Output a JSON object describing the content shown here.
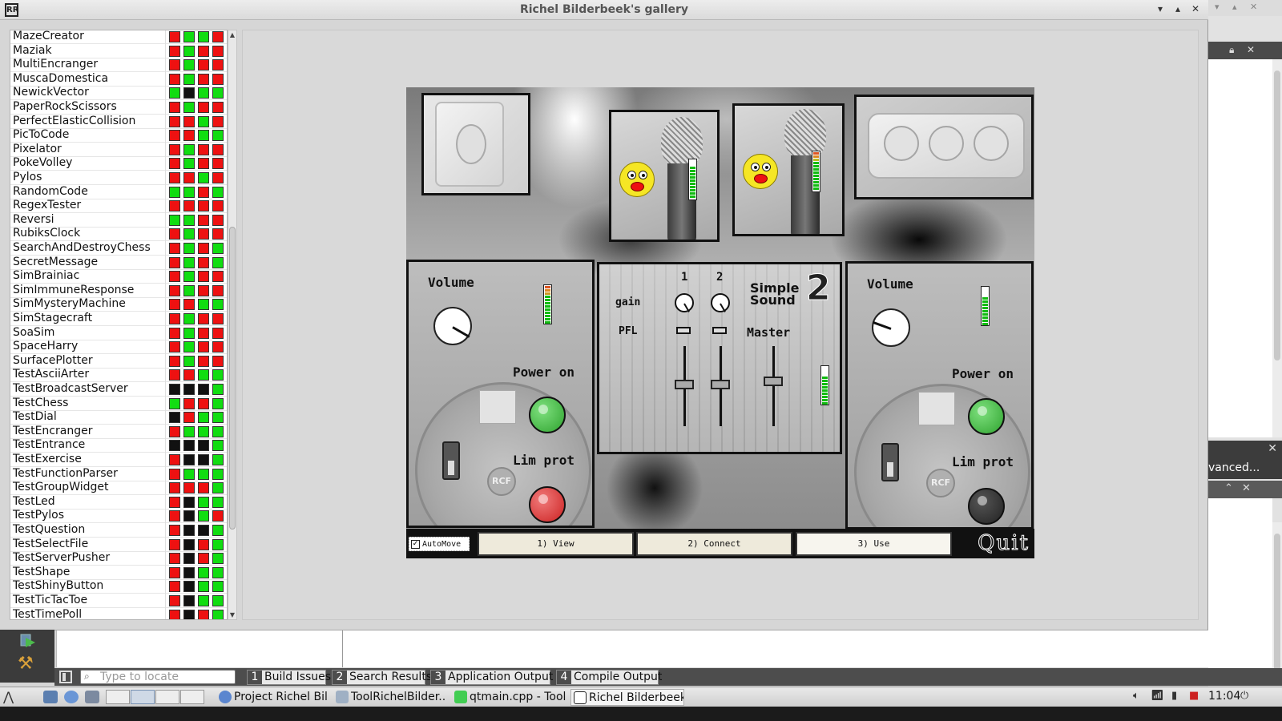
{
  "window": {
    "title": "Richel Bilderbeek's gallery",
    "logo": "RR",
    "controls": [
      "▾",
      "▴",
      "✕"
    ]
  },
  "tools": [
    {
      "name": "MazeCreator",
      "status": [
        "red",
        "green",
        "green",
        "red"
      ]
    },
    {
      "name": "Maziak",
      "status": [
        "red",
        "green",
        "red",
        "red"
      ]
    },
    {
      "name": "MultiEncranger",
      "status": [
        "red",
        "green",
        "red",
        "red"
      ]
    },
    {
      "name": "MuscaDomestica",
      "status": [
        "red",
        "green",
        "red",
        "red"
      ]
    },
    {
      "name": "NewickVector",
      "status": [
        "green",
        "black",
        "green",
        "green"
      ]
    },
    {
      "name": "PaperRockScissors",
      "status": [
        "red",
        "green",
        "red",
        "red"
      ]
    },
    {
      "name": "PerfectElasticCollision",
      "status": [
        "red",
        "red",
        "green",
        "red"
      ]
    },
    {
      "name": "PicToCode",
      "status": [
        "red",
        "red",
        "green",
        "green"
      ]
    },
    {
      "name": "Pixelator",
      "status": [
        "red",
        "green",
        "red",
        "red"
      ]
    },
    {
      "name": "PokeVolley",
      "status": [
        "red",
        "green",
        "red",
        "red"
      ]
    },
    {
      "name": "Pylos",
      "status": [
        "red",
        "red",
        "green",
        "red"
      ]
    },
    {
      "name": "RandomCode",
      "status": [
        "green",
        "green",
        "red",
        "green"
      ]
    },
    {
      "name": "RegexTester",
      "status": [
        "red",
        "red",
        "red",
        "red"
      ]
    },
    {
      "name": "Reversi",
      "status": [
        "green",
        "green",
        "red",
        "red"
      ]
    },
    {
      "name": "RubiksClock",
      "status": [
        "red",
        "green",
        "red",
        "red"
      ]
    },
    {
      "name": "SearchAndDestroyChess",
      "status": [
        "red",
        "green",
        "red",
        "green"
      ]
    },
    {
      "name": "SecretMessage",
      "status": [
        "red",
        "green",
        "red",
        "green"
      ]
    },
    {
      "name": "SimBrainiac",
      "status": [
        "red",
        "green",
        "red",
        "red"
      ]
    },
    {
      "name": "SimImmuneResponse",
      "status": [
        "red",
        "green",
        "red",
        "red"
      ]
    },
    {
      "name": "SimMysteryMachine",
      "status": [
        "red",
        "red",
        "green",
        "green"
      ]
    },
    {
      "name": "SimStagecraft",
      "status": [
        "red",
        "green",
        "red",
        "red"
      ]
    },
    {
      "name": "SoaSim",
      "status": [
        "red",
        "green",
        "red",
        "red"
      ]
    },
    {
      "name": "SpaceHarry",
      "status": [
        "red",
        "green",
        "red",
        "red"
      ]
    },
    {
      "name": "SurfacePlotter",
      "status": [
        "red",
        "green",
        "red",
        "red"
      ]
    },
    {
      "name": "TestAsciiArter",
      "status": [
        "red",
        "red",
        "green",
        "green"
      ]
    },
    {
      "name": "TestBroadcastServer",
      "status": [
        "black",
        "black",
        "black",
        "green"
      ]
    },
    {
      "name": "TestChess",
      "status": [
        "green",
        "red",
        "red",
        "green"
      ]
    },
    {
      "name": "TestDial",
      "status": [
        "black",
        "red",
        "green",
        "green"
      ]
    },
    {
      "name": "TestEncranger",
      "status": [
        "red",
        "green",
        "green",
        "green"
      ]
    },
    {
      "name": "TestEntrance",
      "status": [
        "black",
        "black",
        "black",
        "green"
      ]
    },
    {
      "name": "TestExercise",
      "status": [
        "red",
        "black",
        "black",
        "green"
      ]
    },
    {
      "name": "TestFunctionParser",
      "status": [
        "red",
        "green",
        "green",
        "green"
      ]
    },
    {
      "name": "TestGroupWidget",
      "status": [
        "red",
        "red",
        "red",
        "green"
      ]
    },
    {
      "name": "TestLed",
      "status": [
        "red",
        "black",
        "green",
        "green"
      ]
    },
    {
      "name": "TestPylos",
      "status": [
        "red",
        "black",
        "green",
        "red"
      ]
    },
    {
      "name": "TestQuestion",
      "status": [
        "red",
        "black",
        "black",
        "green"
      ]
    },
    {
      "name": "TestSelectFile",
      "status": [
        "red",
        "black",
        "red",
        "green"
      ]
    },
    {
      "name": "TestServerPusher",
      "status": [
        "red",
        "black",
        "red",
        "green"
      ]
    },
    {
      "name": "TestShape",
      "status": [
        "red",
        "black",
        "green",
        "green"
      ]
    },
    {
      "name": "TestShinyButton",
      "status": [
        "red",
        "black",
        "green",
        "green"
      ]
    },
    {
      "name": "TestTicTacToe",
      "status": [
        "red",
        "black",
        "green",
        "green"
      ]
    },
    {
      "name": "TestTimePoll",
      "status": [
        "red",
        "black",
        "red",
        "green"
      ]
    }
  ],
  "status_colors": {
    "red": "#ee1111",
    "green": "#11dd11",
    "black": "#111111"
  },
  "demo": {
    "left_speaker": {
      "volume_label": "Volume",
      "power_label": "Power on",
      "lim_label": "Lim prot",
      "rcf": "RCF",
      "power_led": "#2fa32f",
      "lim_led": "#cc2222"
    },
    "right_speaker": {
      "volume_label": "Volume",
      "power_label": "Power on",
      "lim_label": "Lim prot",
      "rcf": "RCF",
      "power_led": "#2fa32f",
      "lim_led": "#222222"
    },
    "mixer": {
      "channel1": "1",
      "channel2": "2",
      "gain_label": "gain",
      "pfl_label": "PFL",
      "master_label": "Master",
      "logo_line1": "Simple",
      "logo_line2": "Sound",
      "logo_number": "2"
    },
    "autoMove_label": "AutoMove",
    "autoMove_checked": "✓",
    "step_buttons": [
      "1) View",
      "2) Connect",
      "3) Use"
    ],
    "active_step": 2,
    "quit_label": "Quit"
  },
  "creator": {
    "locate_placeholder": "Type to locate",
    "output_tabs": [
      {
        "num": "1",
        "label": "Build Issues"
      },
      {
        "num": "2",
        "label": "Search Results"
      },
      {
        "num": "3",
        "label": "Application Output"
      },
      {
        "num": "4",
        "label": "Compile Output"
      }
    ]
  },
  "background_app": {
    "panel_text": "vanced..."
  },
  "taskbar": {
    "tasks": [
      {
        "label": "Project Richel Bil...",
        "icon": "browser-icon"
      },
      {
        "label": "ToolRichelBilder...",
        "icon": "folder-icon"
      },
      {
        "label": "qtmain.cpp - Tool...",
        "icon": "qt-creator-icon"
      },
      {
        "label": "Richel Bilderbeek...",
        "icon": "app-icon"
      }
    ],
    "clock": "11:04"
  }
}
